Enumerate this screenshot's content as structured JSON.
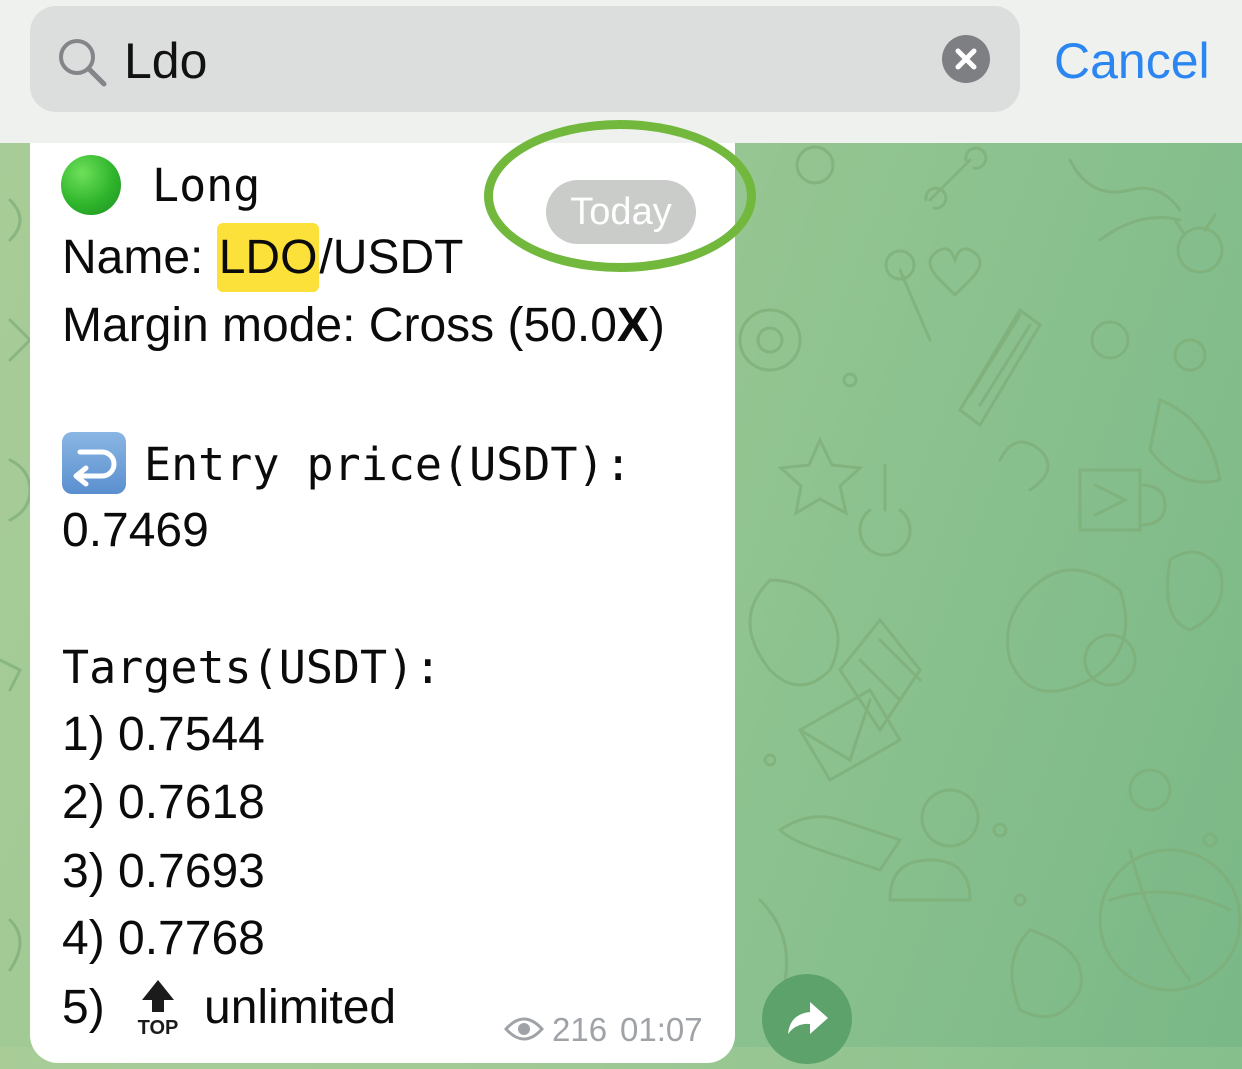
{
  "search": {
    "query": "Ldo",
    "cancel_label": "Cancel",
    "icon": "search-icon",
    "clear_icon": "clear-icon"
  },
  "message": {
    "direction_label": "Long",
    "direction_icon": "green-circle-icon",
    "name_prefix": "Name: ",
    "name_highlight": "LDO",
    "name_suffix": "/USDT",
    "margin_prefix": "Margin mode: Cross (50.0",
    "margin_bold": "X",
    "margin_suffix": ")",
    "entry_icon": "return-arrow-icon",
    "entry_label": "Entry price(USDT):",
    "entry_value": "0.7469",
    "targets_label": "Targets(USDT):",
    "targets": [
      "1) 0.7544",
      "2) 0.7618",
      "3) 0.7693",
      "4) 0.7768"
    ],
    "target5_prefix": "5)",
    "target5_icon_label": "TOP",
    "target5_value": "unlimited",
    "views": "216",
    "time": "01:07"
  },
  "date_badge": "Today",
  "colors": {
    "accent": "#2b86f2",
    "highlight": "#fde13b",
    "annotation_ring": "#72b83d",
    "wallpaper": "#9fc994"
  }
}
